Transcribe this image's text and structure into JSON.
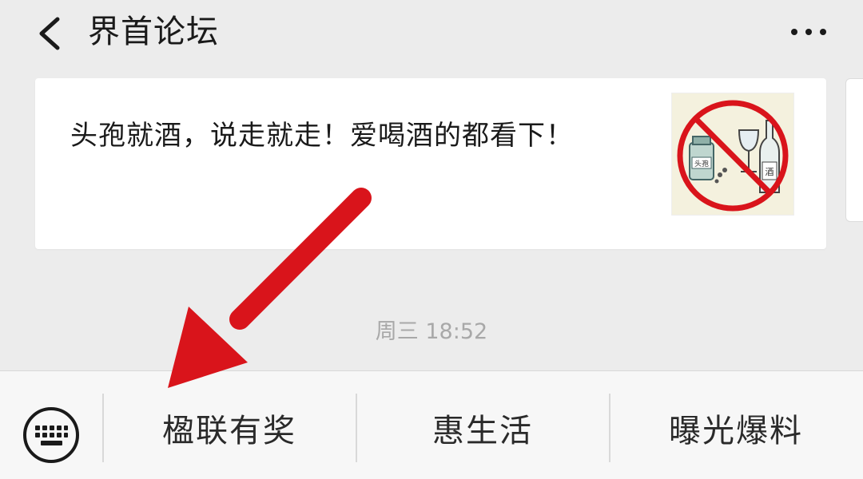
{
  "header": {
    "title": "界首论坛",
    "back_icon": "chevron-left-icon",
    "more_icon": "more-horizontal-icon"
  },
  "article": {
    "text": "头孢就酒，说走就走！爱喝酒的都看下！",
    "thumbnail_icon": "no-alcohol-illustration",
    "thumbnail_labels": {
      "bottle_label": "酒",
      "medicine_label": "头孢"
    }
  },
  "timestamp": "周三 18:52",
  "menu": {
    "keyboard_icon": "keyboard-icon",
    "items": [
      {
        "label": "楹联有奖"
      },
      {
        "label": "惠生活"
      },
      {
        "label": "曝光爆料"
      }
    ]
  },
  "colors": {
    "background": "#ececec",
    "card": "#ffffff",
    "annotation_arrow": "#d9141b"
  }
}
